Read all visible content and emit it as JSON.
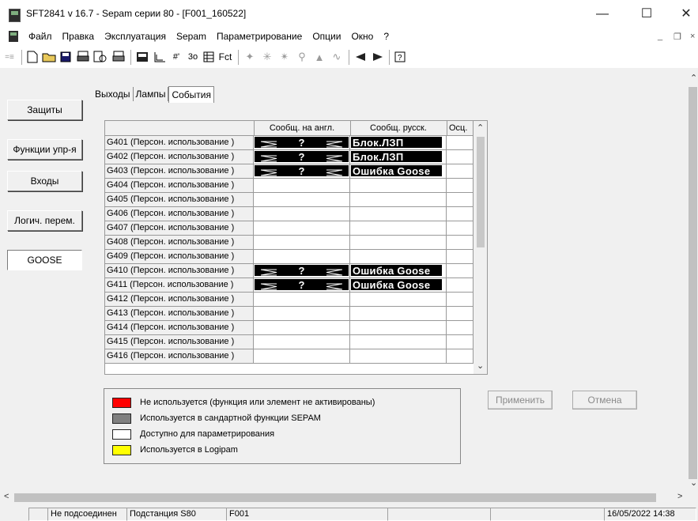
{
  "window": {
    "title": "SFT2841  v 16.7 - Sepam серии 80 - [F001_160522]"
  },
  "menu": [
    "Файл",
    "Правка",
    "Эксплуатация",
    "Sepam",
    "Параметрирование",
    "Опции",
    "Окно",
    "?"
  ],
  "toolbar": {
    "fct_label": "Fct"
  },
  "sidebar": [
    "Защиты",
    "Функции упр-я",
    "Входы",
    "Логич. перем.",
    "GOOSE"
  ],
  "tabs": [
    "Выходы",
    "Лампы",
    "События"
  ],
  "table": {
    "headers": [
      "",
      "Сообщ. на англ.",
      "Сообщ. русск.",
      "Осц."
    ],
    "rows": [
      {
        "name": "G401 (Персон. использование )",
        "en": "?",
        "ru": "Блок.ЛЗП"
      },
      {
        "name": "G402 (Персон. использование )",
        "en": "?",
        "ru": "Блок.ЛЗП"
      },
      {
        "name": "G403 (Персон. использование )",
        "en": "?",
        "ru": "Ошибка Goose"
      },
      {
        "name": "G404 (Персон. использование )",
        "en": "",
        "ru": ""
      },
      {
        "name": "G405 (Персон. использование )",
        "en": "",
        "ru": ""
      },
      {
        "name": "G406 (Персон. использование )",
        "en": "",
        "ru": ""
      },
      {
        "name": "G407 (Персон. использование )",
        "en": "",
        "ru": ""
      },
      {
        "name": "G408 (Персон. использование )",
        "en": "",
        "ru": ""
      },
      {
        "name": "G409 (Персон. использование )",
        "en": "",
        "ru": ""
      },
      {
        "name": "G410 (Персон. использование )",
        "en": "?",
        "ru": "Ошибка Goose"
      },
      {
        "name": "G411 (Персон. использование )",
        "en": "?",
        "ru": "Ошибка Goose"
      },
      {
        "name": "G412 (Персон. использование )",
        "en": "",
        "ru": ""
      },
      {
        "name": "G413 (Персон. использование )",
        "en": "",
        "ru": ""
      },
      {
        "name": "G414 (Персон. использование )",
        "en": "",
        "ru": ""
      },
      {
        "name": "G415 (Персон. использование )",
        "en": "",
        "ru": ""
      },
      {
        "name": "G416 (Персон. использование )",
        "en": "",
        "ru": ""
      }
    ]
  },
  "legend": [
    {
      "color": "#ff0000",
      "label": "Не используется (функция или элемент не активированы)"
    },
    {
      "color": "#808080",
      "label": "Используется в сандартной функции SEPAM"
    },
    {
      "color": "#ffffff",
      "label": "Доступно для параметрирования"
    },
    {
      "color": "#ffff00",
      "label": "Используется в Logipam"
    }
  ],
  "buttons": {
    "apply": "Применить",
    "cancel": "Отмена"
  },
  "status": {
    "connection": "Не подсоединен",
    "substation": "Подстанция S80",
    "file": "F001",
    "datetime": "16/05/2022 14:38"
  }
}
